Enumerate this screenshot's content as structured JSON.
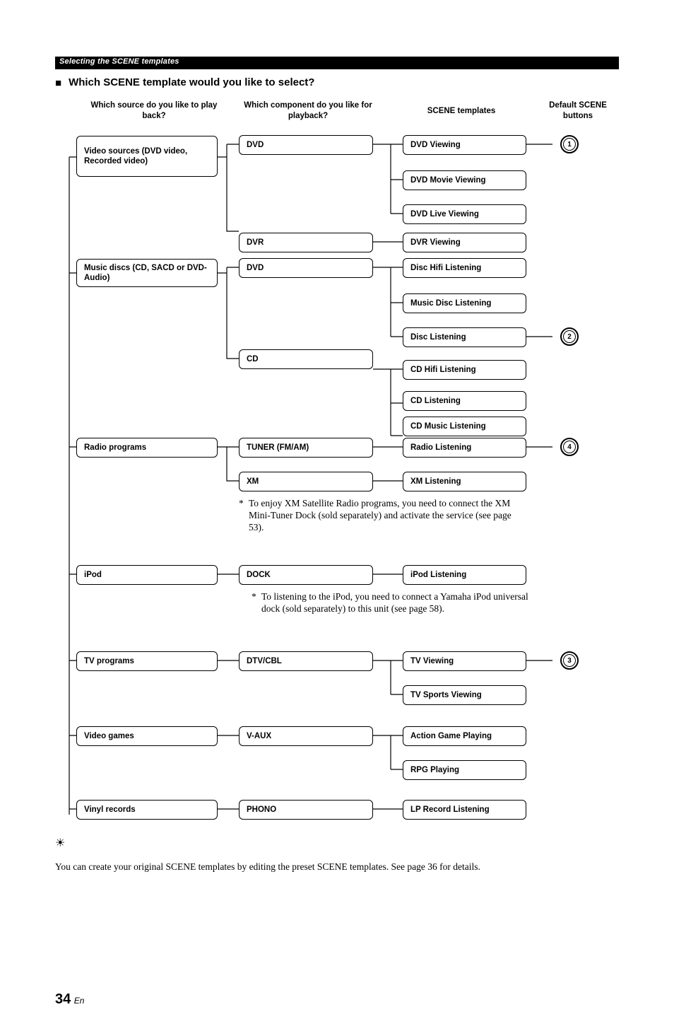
{
  "header_bar": "Selecting the SCENE templates",
  "main_title": "Which SCENE template would you like to select?",
  "col_heads": {
    "c1": "Which source do you like to play back?",
    "c2": "Which component do you like for playback?",
    "c3": "SCENE templates",
    "c4": "Default SCENE buttons"
  },
  "sources": {
    "video": "Video sources (DVD video, Recorded video)",
    "music": "Music discs (CD, SACD or DVD-Audio)",
    "radio": "Radio programs",
    "ipod": "iPod",
    "tv": "TV programs",
    "games": "Video games",
    "vinyl": "Vinyl records"
  },
  "components": {
    "dvd1": "DVD",
    "dvr": "DVR",
    "dvd2": "DVD",
    "cd": "CD",
    "tuner": "TUNER (FM/AM)",
    "xm": "XM",
    "dock": "DOCK",
    "dtv": "DTV/CBL",
    "vaux": "V-AUX",
    "phono": "PHONO"
  },
  "templates": {
    "dvdview": "DVD Viewing",
    "dvdmovie": "DVD Movie Viewing",
    "dvdlive": "DVD Live Viewing",
    "dvrview": "DVR Viewing",
    "dischifi": "Disc Hifi Listening",
    "musicdisc": "Music Disc Listening",
    "disclisten": "Disc Listening",
    "cdhifi": "CD Hifi Listening",
    "cdlisten": "CD Listening",
    "cdmusic": "CD Music Listening",
    "radiolisten": "Radio Listening",
    "xmlisten": "XM Listening",
    "ipodlisten": "iPod Listening",
    "tvview": "TV Viewing",
    "tvsports": "TV Sports Viewing",
    "action": "Action Game Playing",
    "rpg": "RPG Playing",
    "lprecord": "LP Record Listening"
  },
  "buttons": {
    "b1": "1",
    "b2": "2",
    "b3": "3",
    "b4": "4"
  },
  "notes": {
    "xm": "To enjoy XM Satellite Radio programs, you need to connect the XM Mini-Tuner Dock (sold separately) and activate the service (see page 53).",
    "ipod": "To listening to the iPod, you need to connect a Yamaha iPod universal dock (sold separately) to this unit (see page 58)."
  },
  "footer": "You can create your original SCENE templates by editing the preset SCENE templates. See page 36 for details.",
  "page_number": "34",
  "page_lang": "En"
}
